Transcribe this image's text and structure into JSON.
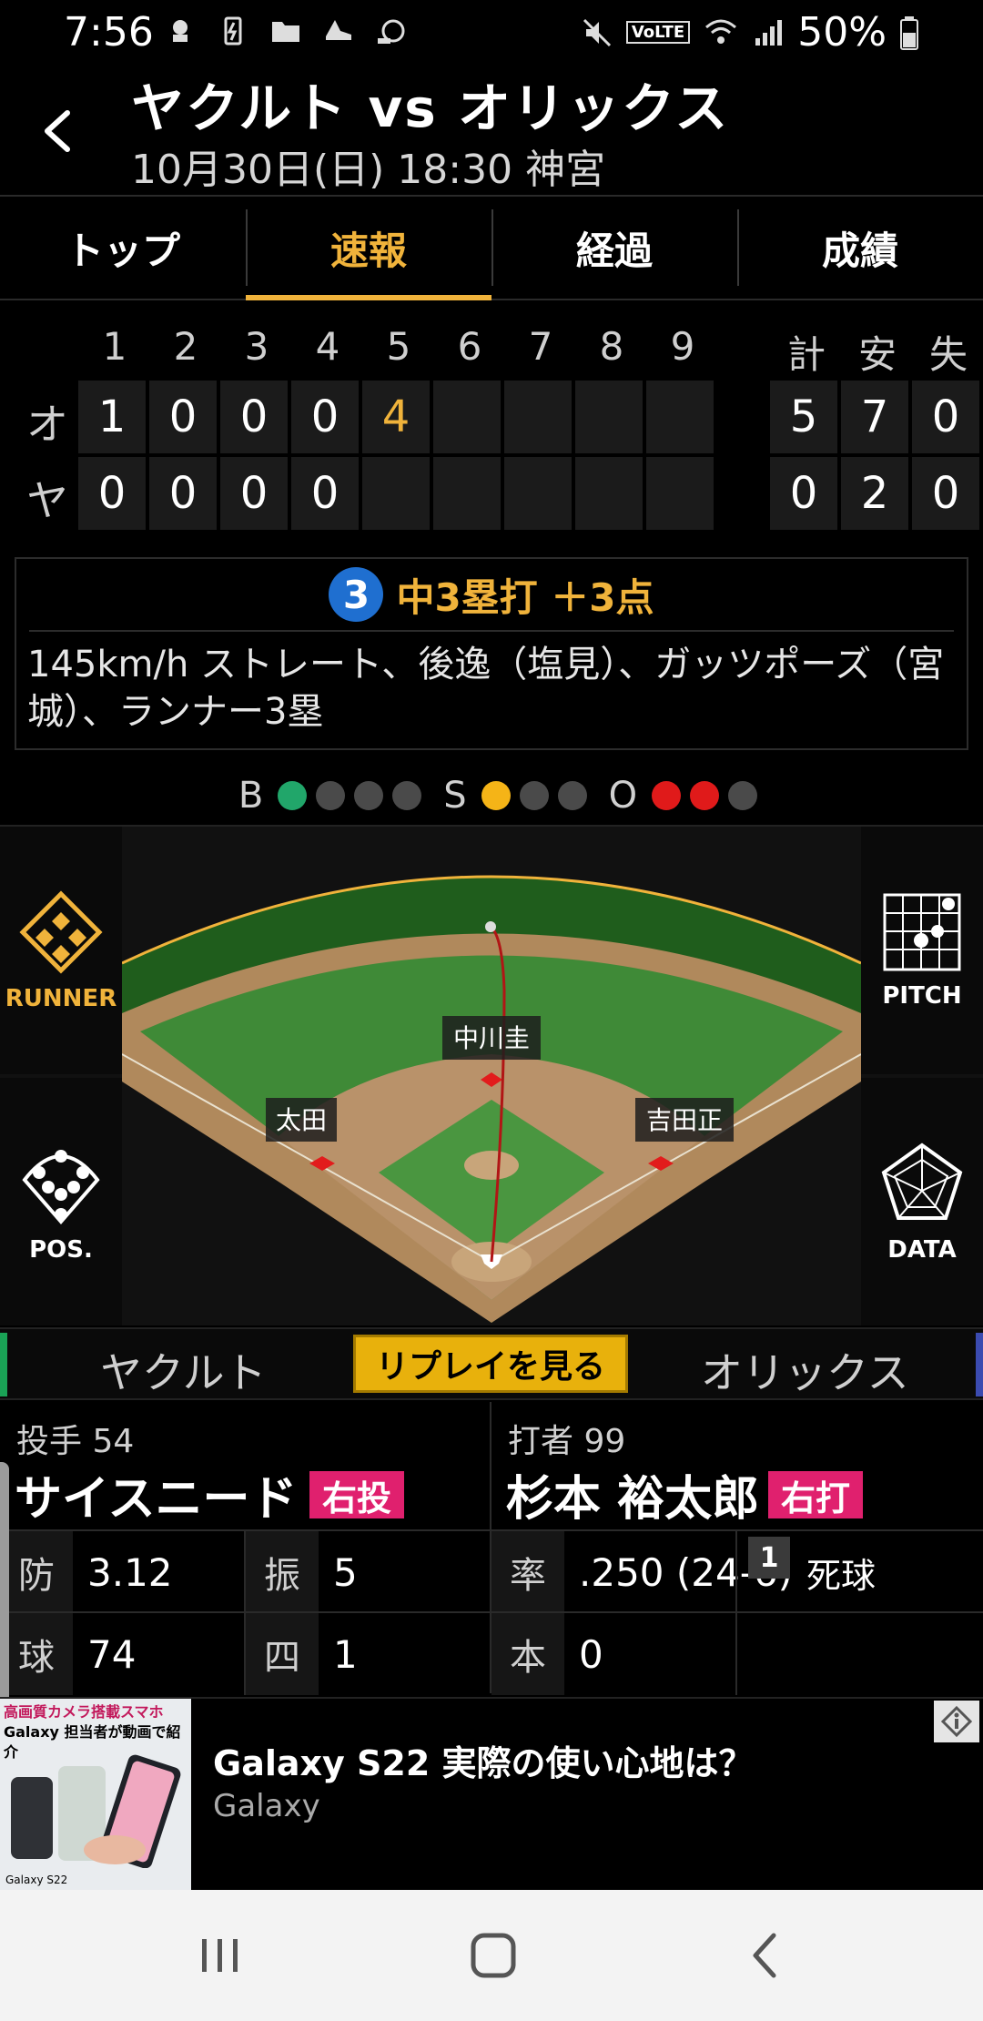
{
  "status_bar": {
    "time": "7:56",
    "battery": "50%",
    "volte_label": "VoLTE"
  },
  "header": {
    "title": "ヤクルト vs オリックス",
    "subtitle": "10月30日(日) 18:30 神宮"
  },
  "tabs": [
    {
      "label": "トップ",
      "active": false
    },
    {
      "label": "速報",
      "active": true
    },
    {
      "label": "経過",
      "active": false
    },
    {
      "label": "成績",
      "active": false
    }
  ],
  "scoreboard": {
    "innings": [
      "1",
      "2",
      "3",
      "4",
      "5",
      "6",
      "7",
      "8",
      "9"
    ],
    "totals_headers": [
      "計",
      "安",
      "失"
    ],
    "teams": [
      {
        "abbr": "オ",
        "scores": [
          "1",
          "0",
          "0",
          "0",
          "4",
          "",
          "",
          "",
          ""
        ],
        "totals": [
          "5",
          "7",
          "0"
        ]
      },
      {
        "abbr": "ヤ",
        "scores": [
          "0",
          "0",
          "0",
          "0",
          "",
          "",
          "",
          "",
          ""
        ],
        "totals": [
          "0",
          "2",
          "0"
        ]
      }
    ],
    "highlight_color": "#f0b33b"
  },
  "play": {
    "number": "3",
    "title": "中3塁打 ＋3点",
    "description": "145km/h ストレート、後逸（塩見）、ガッツポーズ（宮城）、ランナー3塁"
  },
  "count": {
    "b_label": "B",
    "s_label": "S",
    "o_label": "O",
    "balls": 1,
    "strikes": 1,
    "outs": 2,
    "ball_max": 4,
    "strike_max": 3,
    "out_max": 3
  },
  "side_buttons": {
    "runner": "RUNNER",
    "pitch": "PITCH",
    "pos": "POS.",
    "data": "DATA"
  },
  "field": {
    "players": [
      {
        "name": "中川圭"
      },
      {
        "name": "太田"
      },
      {
        "name": "吉田正"
      }
    ]
  },
  "team_bar": {
    "home": "ヤクルト",
    "replay": "リプレイを見る",
    "away": "オリックス"
  },
  "pitcher": {
    "role": "投手 54",
    "name": "サイスニード",
    "hand": "右投",
    "stats": [
      {
        "key": "防",
        "value": "3.12"
      },
      {
        "key": "振",
        "value": "5"
      },
      {
        "key": "球",
        "value": "74"
      },
      {
        "key": "四",
        "value": "1"
      }
    ]
  },
  "batter": {
    "role": "打者 99",
    "name": "杉本 裕太郎",
    "hand": "右打",
    "stats": [
      {
        "key": "率",
        "value": ".250 (24-6)"
      },
      {
        "key": "本",
        "value": "0"
      }
    ],
    "extra_badge": "1",
    "extra_label": "死球"
  },
  "ad": {
    "image_caption_1": "高画質カメラ搭載スマホ",
    "image_caption_2": "Galaxy 担当者が動画で紹介",
    "image_footer": "Galaxy S22",
    "title": "Galaxy S22 実際の使い心地は？",
    "sponsor": "Galaxy"
  }
}
